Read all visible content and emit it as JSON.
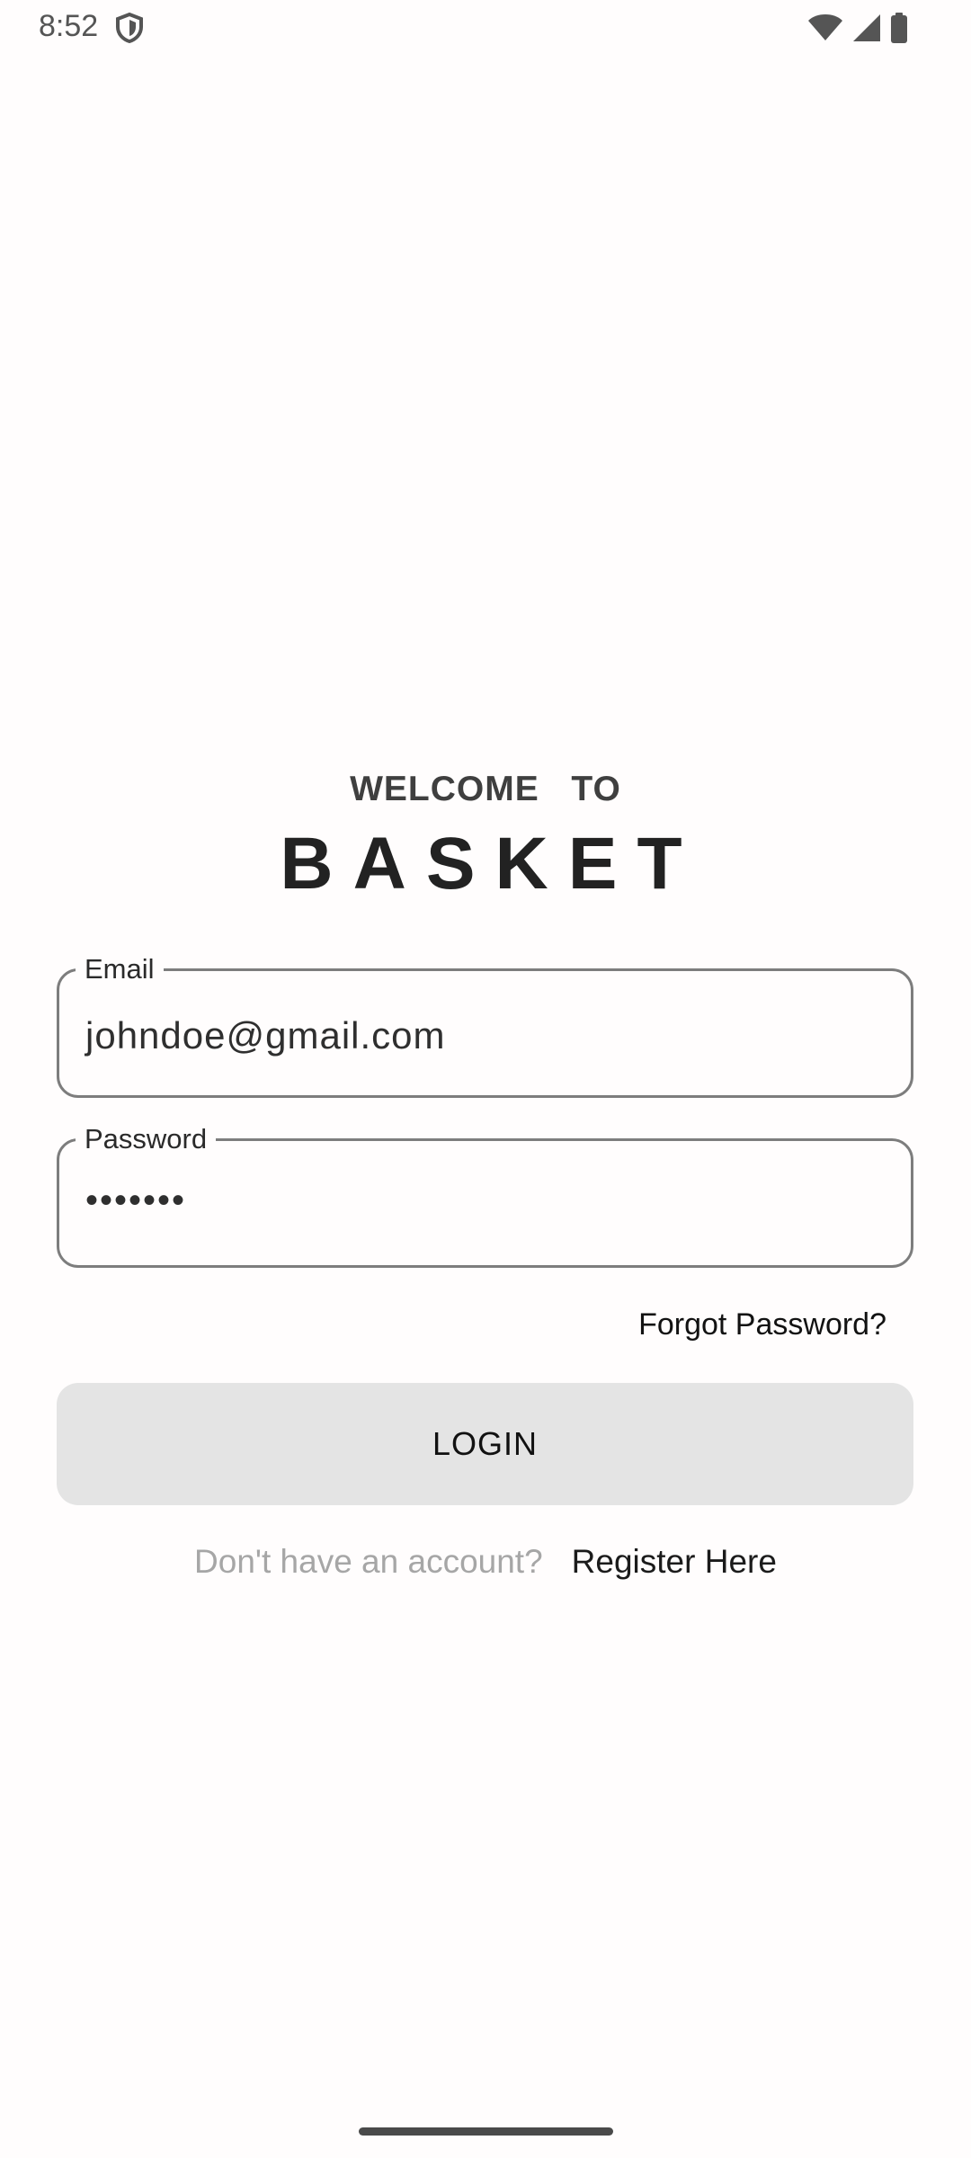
{
  "status_bar": {
    "time": "8:52",
    "icons": [
      "shield-icon",
      "wifi-icon",
      "cell-signal-icon",
      "battery-icon"
    ]
  },
  "header": {
    "welcome": "WELCOME  TO",
    "brand": "BASKET"
  },
  "form": {
    "email": {
      "label": "Email",
      "value": "johndoe@gmail.com"
    },
    "password": {
      "label": "Password",
      "value": "•••••••"
    },
    "forgot_password": "Forgot Password?",
    "login_button": "LOGIN"
  },
  "register": {
    "prompt": "Don't have an account?",
    "link": "Register Here"
  },
  "colors": {
    "background": "#fffdfd",
    "field_border": "#7d7d7d",
    "button_bg": "#e4e4e4",
    "muted_text": "#a6a6a6"
  }
}
